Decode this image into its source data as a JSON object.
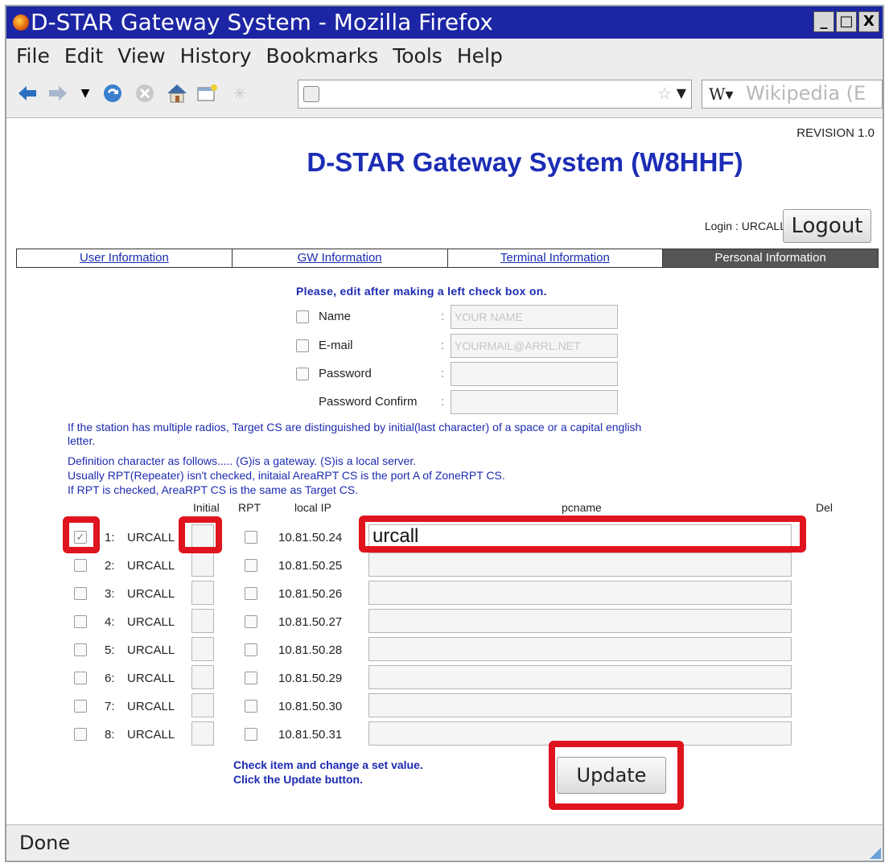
{
  "window": {
    "title": "D-STAR Gateway System - Mozilla Firefox",
    "controls": [
      "_",
      "□",
      "X"
    ]
  },
  "menubar": {
    "items": [
      "File",
      "Edit",
      "View",
      "History",
      "Bookmarks",
      "Tools",
      "Help"
    ]
  },
  "navbar": {
    "icons": [
      "back-icon",
      "forward-icon",
      "history-dropdown-icon",
      "reload-icon",
      "stop-icon",
      "home-icon",
      "new-tab-icon",
      "loading-icon"
    ],
    "url": "",
    "search_engine": "W▾",
    "search_placeholder": "Wikipedia (E"
  },
  "page": {
    "revision": "REVISION 1.0",
    "title": "D-STAR Gateway System (W8HHF)",
    "login_label": "Login : URCALL",
    "logout_label": "Logout",
    "tabs": [
      {
        "label": "User Information",
        "active": false
      },
      {
        "label": "GW Information",
        "active": false
      },
      {
        "label": "Terminal Information",
        "active": false
      },
      {
        "label": "Personal Information",
        "active": true
      }
    ],
    "instruction": "Please, edit after making a left check box on.",
    "form": {
      "name_label": "Name",
      "name_placeholder": "YOUR NAME",
      "email_label": "E-mail",
      "email_placeholder": "YOURMAIL@ARRL.NET",
      "password_label": "Password",
      "password_confirm_label": "Password Confirm"
    },
    "info_lines": [
      "If the station has multiple radios, Target CS are distinguished by initial(last character) of a space or a capital english",
      "letter.",
      "Definition character as follows..... (G)is a gateway. (S)is a local server.",
      "Usually RPT(Repeater) isn't checked, initaial AreaRPT CS is the port A of ZoneRPT CS.",
      "If RPT is checked, AreaRPT CS is the same as Target CS."
    ],
    "table": {
      "headers": {
        "initial": "Initial",
        "rpt": "RPT",
        "local_ip": "local IP",
        "pcname": "pcname",
        "del": "Del"
      },
      "rows": [
        {
          "num": "1:",
          "call": "URCALL",
          "ip": "10.81.50.24",
          "pcname": "urcall",
          "checked": true
        },
        {
          "num": "2:",
          "call": "URCALL",
          "ip": "10.81.50.25",
          "pcname": "",
          "checked": false
        },
        {
          "num": "3:",
          "call": "URCALL",
          "ip": "10.81.50.26",
          "pcname": "",
          "checked": false
        },
        {
          "num": "4:",
          "call": "URCALL",
          "ip": "10.81.50.27",
          "pcname": "",
          "checked": false
        },
        {
          "num": "5:",
          "call": "URCALL",
          "ip": "10.81.50.28",
          "pcname": "",
          "checked": false
        },
        {
          "num": "6:",
          "call": "URCALL",
          "ip": "10.81.50.29",
          "pcname": "",
          "checked": false
        },
        {
          "num": "7:",
          "call": "URCALL",
          "ip": "10.81.50.30",
          "pcname": "",
          "checked": false
        },
        {
          "num": "8:",
          "call": "URCALL",
          "ip": "10.81.50.31",
          "pcname": "",
          "checked": false
        }
      ]
    },
    "bottom_note_1": "Check item and change a set value.",
    "bottom_note_2": "Click the Update button.",
    "update_label": "Update"
  },
  "statusbar": {
    "text": "Done"
  },
  "colors": {
    "titlebar": "#1c25a3",
    "link_blue": "#1c2bb0",
    "active_tab": "#555555",
    "highlight_red": "#e0141e"
  }
}
